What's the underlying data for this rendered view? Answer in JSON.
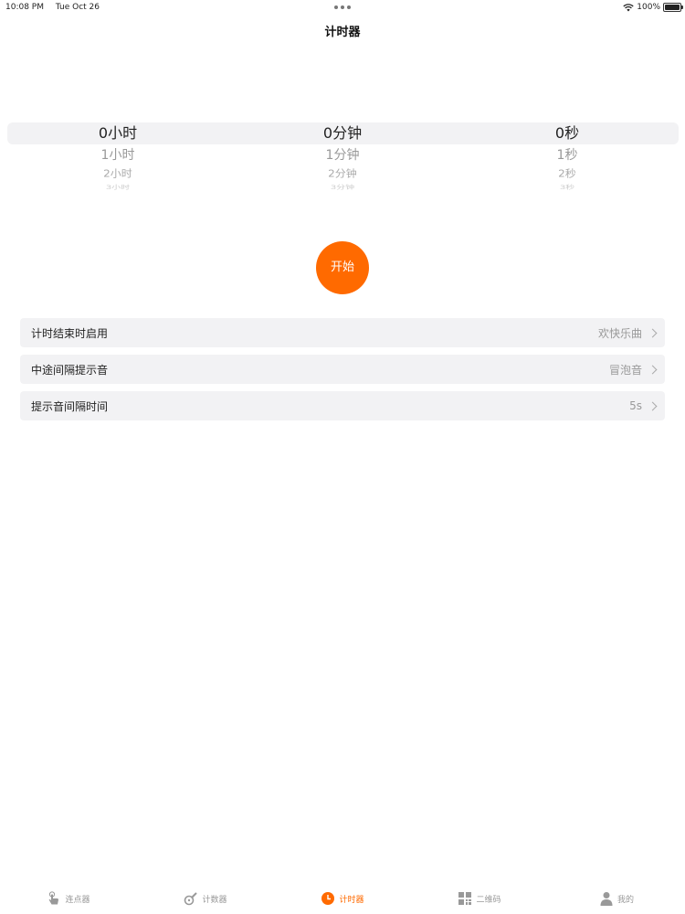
{
  "status": {
    "time": "10:08 PM",
    "date": "Tue Oct 26",
    "battery_text": "100%",
    "battery_level": 1.0
  },
  "nav": {
    "title": "计时器"
  },
  "picker": {
    "hours": [
      "0小时",
      "1小时",
      "2小时",
      "3小时"
    ],
    "minutes": [
      "0分钟",
      "1分钟",
      "2分钟",
      "3分钟"
    ],
    "seconds": [
      "0秒",
      "1秒",
      "2秒",
      "3秒"
    ]
  },
  "start_button": {
    "label": "开始",
    "color": "#ff6a00"
  },
  "settings": [
    {
      "label": "计时结束时启用",
      "value": "欢快乐曲"
    },
    {
      "label": "中途间隔提示音",
      "value": "冒泡音"
    },
    {
      "label": "提示音间隔时间",
      "value": "5s"
    }
  ],
  "tabs": [
    {
      "label": "连点器",
      "icon": "tap-hand-icon"
    },
    {
      "label": "计数器",
      "icon": "counter-icon"
    },
    {
      "label": "计时器",
      "icon": "clock-icon",
      "active": true
    },
    {
      "label": "二维码",
      "icon": "qr-code-icon"
    },
    {
      "label": "我的",
      "icon": "person-icon"
    }
  ],
  "colors": {
    "accent": "#ff6a00",
    "inactive": "#999999"
  }
}
